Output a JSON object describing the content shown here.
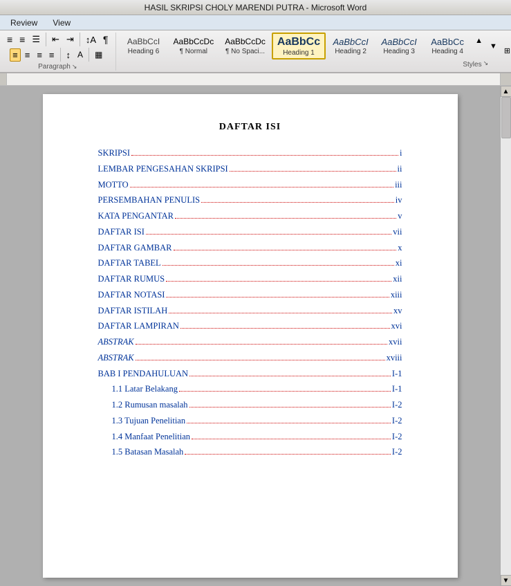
{
  "titlebar": {
    "text": "HASIL SKRIPSI CHOLY MARENDI PUTRA - Microsoft Word"
  },
  "ribbontabs": {
    "tabs": [
      "Review",
      "View"
    ]
  },
  "styles": {
    "label": "Styles",
    "items": [
      {
        "id": "heading6",
        "preview": "AaBbCcI",
        "label": "Heading 6",
        "active": false
      },
      {
        "id": "normal",
        "preview": "AaBbCcDc",
        "label": "¶ Normal",
        "active": false
      },
      {
        "id": "nospacing",
        "preview": "AaBbCcDc",
        "label": "¶ No Spaci...",
        "active": false
      },
      {
        "id": "heading1",
        "preview": "AaBbCc",
        "label": "Heading 1",
        "active": true
      },
      {
        "id": "heading2",
        "preview": "AaBbCcI",
        "label": "Heading 2",
        "active": false
      },
      {
        "id": "heading3",
        "preview": "AaBbCcI",
        "label": "Heading 3",
        "active": false
      },
      {
        "id": "heading4",
        "preview": "AaBbCc",
        "label": "Heading 4",
        "active": false
      }
    ]
  },
  "paragraph": {
    "label": "Paragraph"
  },
  "document": {
    "title": "DAFTAR ISI",
    "toc": [
      {
        "text": "SKRIPSI",
        "page": "i",
        "indent": 0,
        "italic": false
      },
      {
        "text": "LEMBAR PENGESAHAN SKRIPSI",
        "page": "ii",
        "indent": 0,
        "italic": false
      },
      {
        "text": "MOTTO",
        "page": "iii",
        "indent": 0,
        "italic": false
      },
      {
        "text": "PERSEMBAHAN PENULIS",
        "page": "iv",
        "indent": 0,
        "italic": false
      },
      {
        "text": "KATA PENGANTAR",
        "page": "v",
        "indent": 0,
        "italic": false
      },
      {
        "text": "DAFTAR ISI",
        "page": "vii",
        "indent": 0,
        "italic": false
      },
      {
        "text": "DAFTAR GAMBAR",
        "page": "x",
        "indent": 0,
        "italic": false
      },
      {
        "text": "DAFTAR TABEL",
        "page": "xi",
        "indent": 0,
        "italic": false
      },
      {
        "text": "DAFTAR RUMUS",
        "page": "xii",
        "indent": 0,
        "italic": false
      },
      {
        "text": "DAFTAR NOTASI",
        "page": "xiii",
        "indent": 0,
        "italic": false
      },
      {
        "text": "DAFTAR ISTILAH",
        "page": "xv",
        "indent": 0,
        "italic": false
      },
      {
        "text": "DAFTAR LAMPIRAN",
        "page": "xvi",
        "indent": 0,
        "italic": false
      },
      {
        "text": "ABSTRAK",
        "page": "xvii",
        "indent": 0,
        "italic": true
      },
      {
        "text": "ABSTRAK",
        "page": "xviii",
        "indent": 0,
        "italic": true
      },
      {
        "text": "BAB I PENDAHULUAN",
        "page": "I-1",
        "indent": 0,
        "italic": false
      },
      {
        "text": "1.1   Latar Belakang",
        "page": "I-1",
        "indent": 1,
        "italic": false
      },
      {
        "text": "1.2   Rumusan masalah",
        "page": "I-2",
        "indent": 1,
        "italic": false
      },
      {
        "text": "1.3   Tujuan Penelitian",
        "page": "I-2",
        "indent": 1,
        "italic": false
      },
      {
        "text": "1.4   Manfaat Penelitian",
        "page": "I-2",
        "indent": 1,
        "italic": false
      },
      {
        "text": "1.5   Batasan Masalah",
        "page": "I-2",
        "indent": 1,
        "italic": false
      }
    ]
  }
}
